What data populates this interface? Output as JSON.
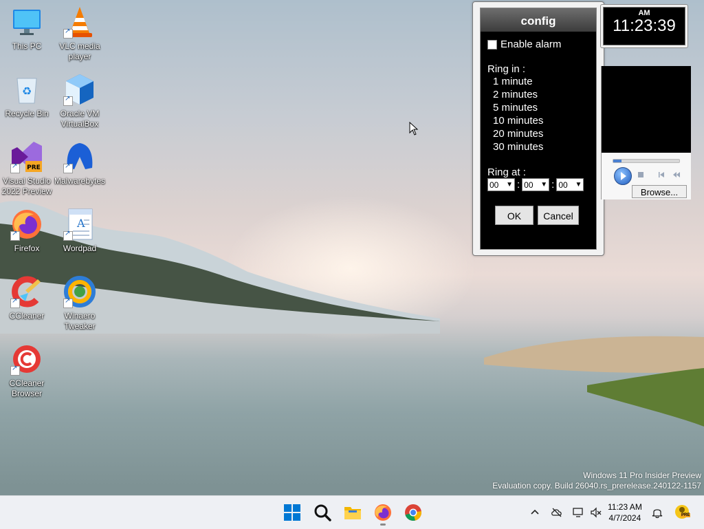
{
  "desktop": {
    "icons": [
      {
        "label": "This PC"
      },
      {
        "label": "VLC media player"
      },
      {
        "label": "Recycle Bin"
      },
      {
        "label": "Oracle VM VirtualBox"
      },
      {
        "label": "Visual Studio 2022 Preview"
      },
      {
        "label": "Malwarebytes"
      },
      {
        "label": "Firefox"
      },
      {
        "label": "Wordpad"
      },
      {
        "label": "CCleaner"
      },
      {
        "label": "Winaero Tweaker"
      },
      {
        "label": "CCleaner Browser"
      }
    ]
  },
  "config": {
    "title": "config",
    "enable_alarm": "Enable alarm",
    "ring_in_label": "Ring in :",
    "ring_in_options": [
      "1 minute",
      "2 minutes",
      "5 minutes",
      "10 minutes",
      "20 minutes",
      "30 minutes"
    ],
    "ring_at_label": "Ring at :",
    "hour": "00",
    "minute": "00",
    "second": "00",
    "sep": ":",
    "ok": "OK",
    "cancel": "Cancel"
  },
  "clock": {
    "ampm": "AM",
    "time": "11:23:39"
  },
  "player": {
    "browse": "Browse..."
  },
  "watermark": {
    "line1": "Windows 11 Pro Insider Preview",
    "line2": "Evaluation copy. Build 26040.rs_prerelease.240122-1157"
  },
  "taskbar": {
    "time": "11:23 AM",
    "date": "4/7/2024",
    "tray_badge": "PRE"
  },
  "colors": {
    "accent": "#0067c0",
    "window_bg": "#000000"
  }
}
